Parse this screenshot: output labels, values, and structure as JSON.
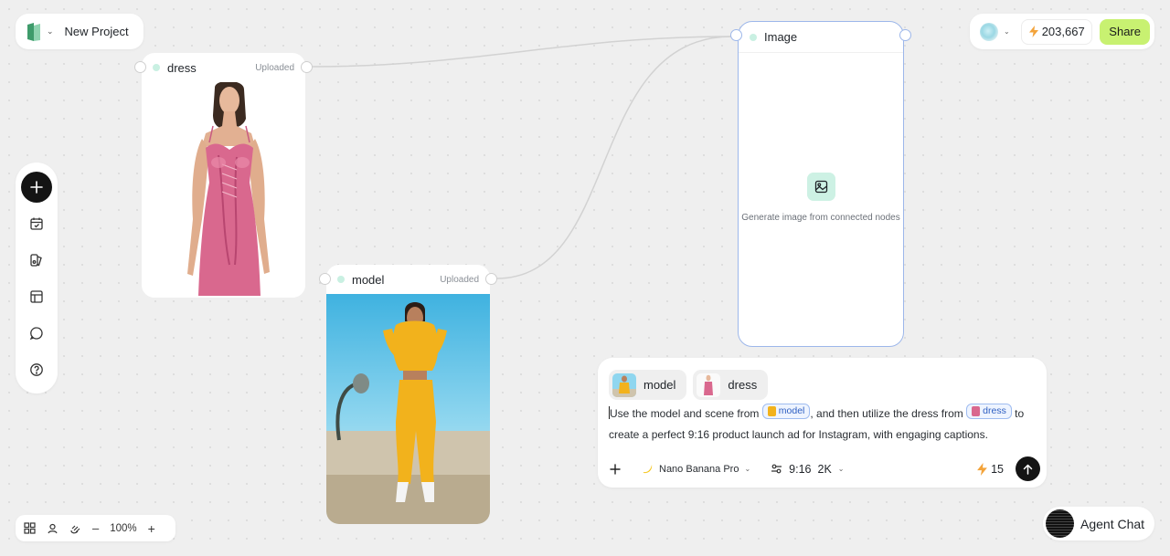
{
  "project": {
    "name": "New Project"
  },
  "top_right": {
    "credits": "203,667",
    "share_label": "Share"
  },
  "left_toolbar": {
    "tools": [
      "add-icon",
      "task-icon",
      "assets-icon",
      "layout-icon",
      "chat-icon",
      "help-icon"
    ]
  },
  "nodes": {
    "dress": {
      "title": "dress",
      "status": "Uploaded"
    },
    "model": {
      "title": "model",
      "status": "Uploaded"
    },
    "image": {
      "title": "Image",
      "hint": "Generate image from connected nodes"
    }
  },
  "prompt": {
    "chips": [
      {
        "label": "model"
      },
      {
        "label": "dress"
      }
    ],
    "text_1": "Use the model and scene from",
    "mention_1": "model",
    "text_2": ", and then utilize the dress from",
    "mention_2": "dress",
    "text_3": "to create a perfect 9:16 product launch ad for Instagram, with engaging captions.",
    "model_name": "Nano Banana Pro",
    "aspect_ratio": "9:16",
    "resolution": "2K",
    "cost": "15"
  },
  "zoom": {
    "level": "100%"
  },
  "agent_chat": {
    "label": "Agent Chat"
  },
  "colors": {
    "accent_green": "#c8f171",
    "node_dot": "#c9f0e2",
    "selected_border": "#9db7ea",
    "dress_pink": "#d9688e",
    "model_yellow": "#f2b21c",
    "sky_blue": "#4fb9e3"
  }
}
